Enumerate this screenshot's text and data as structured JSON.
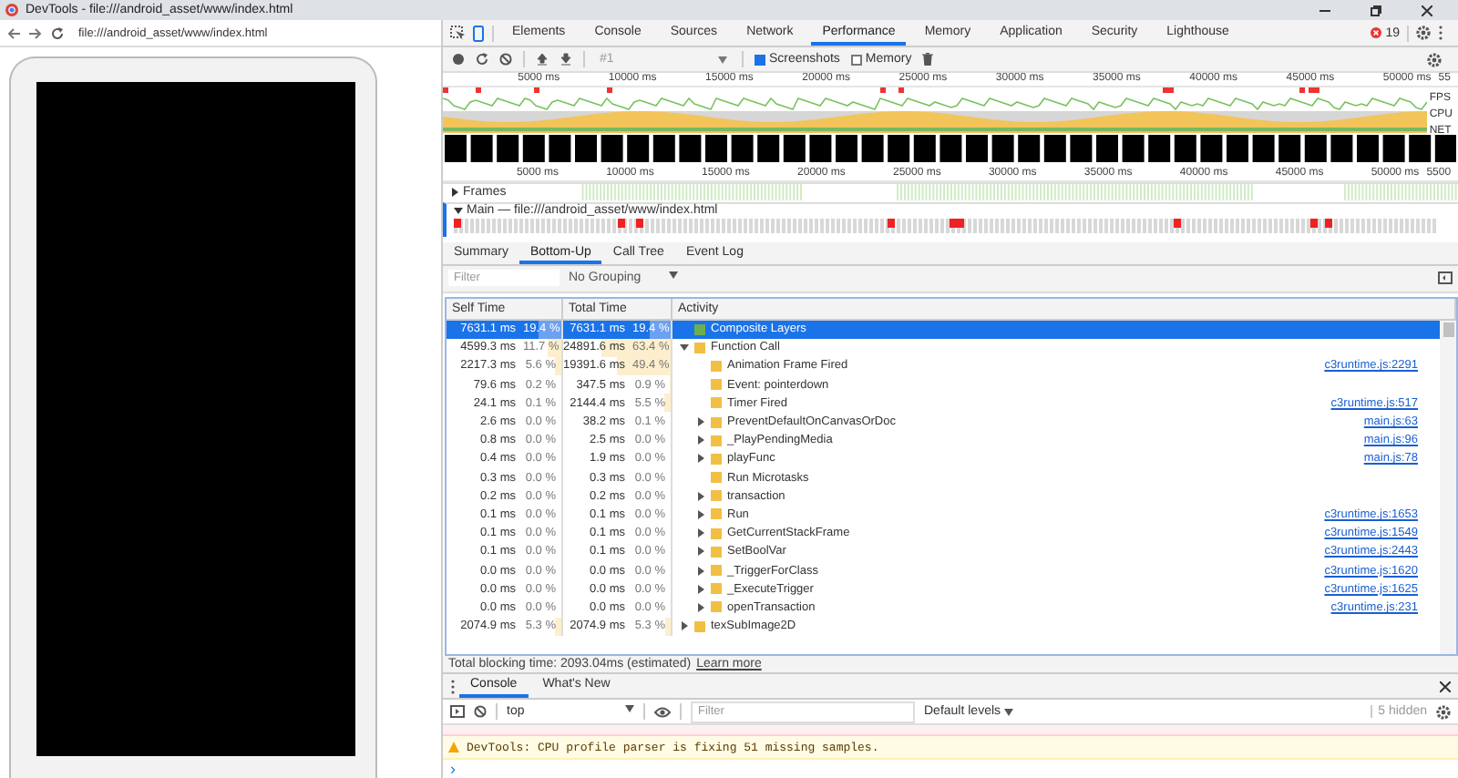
{
  "window": {
    "title": "DevTools - file:///android_asset/www/index.html"
  },
  "address_bar": {
    "url": "file:///android_asset/www/index.html"
  },
  "devtools": {
    "tabs": [
      {
        "label": "Elements",
        "selected": false
      },
      {
        "label": "Console",
        "selected": false
      },
      {
        "label": "Sources",
        "selected": false
      },
      {
        "label": "Network",
        "selected": false
      },
      {
        "label": "Performance",
        "selected": true
      },
      {
        "label": "Memory",
        "selected": false
      },
      {
        "label": "Application",
        "selected": false
      },
      {
        "label": "Security",
        "selected": false
      },
      {
        "label": "Lighthouse",
        "selected": false
      }
    ],
    "error_count": "19"
  },
  "perf_toolbar": {
    "recording": "#1",
    "options": [
      {
        "label": "Screenshots",
        "checked": true
      },
      {
        "label": "Memory",
        "checked": false
      }
    ]
  },
  "overview": {
    "ticks": [
      "5000 ms",
      "10000 ms",
      "15000 ms",
      "20000 ms",
      "25000 ms",
      "30000 ms",
      "35000 ms",
      "40000 ms",
      "45000 ms",
      "50000 ms",
      "55"
    ],
    "lanes": [
      "FPS",
      "CPU",
      "NET"
    ]
  },
  "timeline": {
    "ticks": [
      "5000 ms",
      "10000 ms",
      "15000 ms",
      "20000 ms",
      "25000 ms",
      "30000 ms",
      "35000 ms",
      "40000 ms",
      "45000 ms",
      "50000 ms",
      "5500"
    ],
    "tracks": [
      {
        "label": "Frames",
        "expanded": false
      },
      {
        "label": "Main — file:///android_asset/www/index.html",
        "expanded": true
      }
    ]
  },
  "detail_tabs": [
    {
      "label": "Summary",
      "selected": false
    },
    {
      "label": "Bottom-Up",
      "selected": true
    },
    {
      "label": "Call Tree",
      "selected": false
    },
    {
      "label": "Event Log",
      "selected": false
    }
  ],
  "filter": {
    "placeholder": "Filter"
  },
  "grouping": "No Grouping",
  "table": {
    "columns": [
      "Self Time",
      "Total Time",
      "Activity"
    ],
    "rows": [
      {
        "self": "7631.1 ms",
        "self_pct": "19.4 %",
        "total": "7631.1 ms",
        "total_pct": "19.4 %",
        "activity": "Composite Layers",
        "color": "#6aaf50",
        "selected": true
      },
      {
        "self": "4599.3 ms",
        "self_pct": "11.7 %",
        "total": "24891.6 ms",
        "total_pct": "63.4 %",
        "activity": "Function Call",
        "color": "#f2bf45",
        "selected": false,
        "expanded": true,
        "children": [
          {
            "self": "2217.3 ms",
            "self_pct": "5.6 %",
            "total": "19391.6 ms",
            "total_pct": "49.4 %",
            "activity": "Animation Frame Fired",
            "color": "#f2bf45",
            "selected": false,
            "link": "c3runtime.js:2291"
          },
          {
            "self": "79.6 ms",
            "self_pct": "0.2 %",
            "total": "347.5 ms",
            "total_pct": "0.9 %",
            "activity": "Event: pointerdown",
            "color": "#f2bf45",
            "selected": false
          },
          {
            "self": "24.1 ms",
            "self_pct": "0.1 %",
            "total": "2144.4 ms",
            "total_pct": "5.5 %",
            "activity": "Timer Fired",
            "color": "#f2bf45",
            "selected": false,
            "link": "c3runtime.js:517"
          },
          {
            "self": "2.6 ms",
            "self_pct": "0.0 %",
            "total": "38.2 ms",
            "total_pct": "0.1 %",
            "activity": "PreventDefaultOnCanvasOrDoc",
            "color": "#f2bf45",
            "selected": false,
            "expanded": false,
            "link": "main.js:63"
          },
          {
            "self": "0.8 ms",
            "self_pct": "0.0 %",
            "total": "2.5 ms",
            "total_pct": "0.0 %",
            "activity": "_PlayPendingMedia",
            "color": "#f2bf45",
            "selected": false,
            "expanded": false,
            "link": "main.js:96"
          },
          {
            "self": "0.4 ms",
            "self_pct": "0.0 %",
            "total": "1.9 ms",
            "total_pct": "0.0 %",
            "activity": "playFunc",
            "color": "#f2bf45",
            "selected": false,
            "expanded": false,
            "link": "main.js:78"
          },
          {
            "self": "0.3 ms",
            "self_pct": "0.0 %",
            "total": "0.3 ms",
            "total_pct": "0.0 %",
            "activity": "Run Microtasks",
            "color": "#f2bf45",
            "selected": false
          },
          {
            "self": "0.2 ms",
            "self_pct": "0.0 %",
            "total": "0.2 ms",
            "total_pct": "0.0 %",
            "activity": "transaction",
            "color": "#f2bf45",
            "selected": false,
            "expanded": false
          },
          {
            "self": "0.1 ms",
            "self_pct": "0.0 %",
            "total": "0.1 ms",
            "total_pct": "0.0 %",
            "activity": "Run",
            "color": "#f2bf45",
            "selected": false,
            "expanded": false,
            "link": "c3runtime.js:1653"
          },
          {
            "self": "0.1 ms",
            "self_pct": "0.0 %",
            "total": "0.1 ms",
            "total_pct": "0.0 %",
            "activity": "GetCurrentStackFrame",
            "color": "#f2bf45",
            "selected": false,
            "expanded": false,
            "link": "c3runtime.js:1549"
          },
          {
            "self": "0.1 ms",
            "self_pct": "0.0 %",
            "total": "0.1 ms",
            "total_pct": "0.0 %",
            "activity": "SetBoolVar",
            "color": "#f2bf45",
            "selected": false,
            "expanded": false,
            "link": "c3runtime.js:2443"
          },
          {
            "self": "0.0 ms",
            "self_pct": "0.0 %",
            "total": "0.0 ms",
            "total_pct": "0.0 %",
            "activity": "_TriggerForClass",
            "color": "#f2bf45",
            "selected": false,
            "expanded": false,
            "link": "c3runtime.js:1620"
          },
          {
            "self": "0.0 ms",
            "self_pct": "0.0 %",
            "total": "0.0 ms",
            "total_pct": "0.0 %",
            "activity": "_ExecuteTrigger",
            "color": "#f2bf45",
            "selected": false,
            "expanded": false,
            "link": "c3runtime.js:1625"
          },
          {
            "self": "0.0 ms",
            "self_pct": "0.0 %",
            "total": "0.0 ms",
            "total_pct": "0.0 %",
            "activity": "openTransaction",
            "color": "#f2bf45",
            "selected": false,
            "expanded": false,
            "link": "c3runtime.js:231"
          }
        ]
      },
      {
        "self": "2074.9 ms",
        "self_pct": "5.3 %",
        "total": "2074.9 ms",
        "total_pct": "5.3 %",
        "activity": "texSubImage2D",
        "color": "#f2bf45",
        "selected": false,
        "expanded": false
      }
    ]
  },
  "status": {
    "text": "Total blocking time: 2093.04ms (estimated)",
    "link": "Learn more"
  },
  "drawer": {
    "tabs": [
      {
        "label": "Console",
        "selected": true
      },
      {
        "label": "What's New",
        "selected": false
      }
    ],
    "context": "top",
    "filter": {
      "placeholder": "Filter"
    },
    "levels": "Default levels",
    "hidden": "5 hidden",
    "messages": [
      {
        "kind": "warning",
        "text": "DevTools: CPU profile parser is fixing 51 missing samples."
      }
    ],
    "prompt": "›"
  }
}
